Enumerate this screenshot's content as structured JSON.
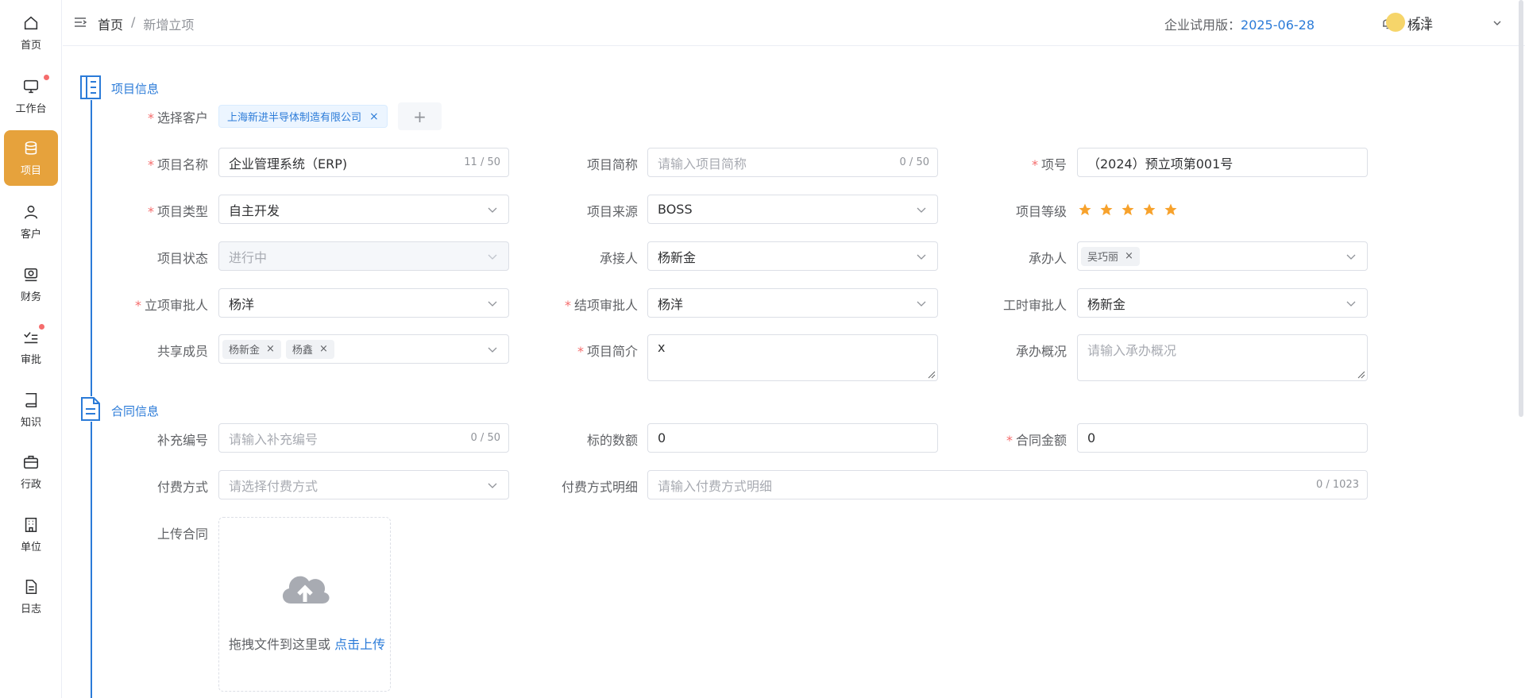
{
  "sidebar": {
    "items": [
      {
        "label": "首页",
        "icon": "home-icon"
      },
      {
        "label": "工作台",
        "icon": "monitor-icon",
        "badge": true
      },
      {
        "label": "项目",
        "icon": "database-icon",
        "active": true
      },
      {
        "label": "客户",
        "icon": "user-icon"
      },
      {
        "label": "财务",
        "icon": "money-icon"
      },
      {
        "label": "审批",
        "icon": "checklist-icon",
        "badge": true
      },
      {
        "label": "知识",
        "icon": "book-icon"
      },
      {
        "label": "行政",
        "icon": "briefcase-icon"
      },
      {
        "label": "单位",
        "icon": "building-icon"
      },
      {
        "label": "日志",
        "icon": "document-icon"
      }
    ]
  },
  "header": {
    "breadcrumb": [
      "首页",
      "/",
      "新增立项"
    ],
    "trial_label": "企业试用版：",
    "trial_date": "2025-06-28",
    "username": "杨洋"
  },
  "sections": {
    "project_info": "项目信息",
    "contract_info": "合同信息"
  },
  "form": {
    "customer": {
      "label": "选择客户",
      "tag": "上海新进半导体制造有限公司"
    },
    "project_name": {
      "label": "项目名称",
      "value": "企业管理系统（ERP)",
      "count": "11 / 50"
    },
    "project_short": {
      "label": "项目简称",
      "placeholder": "请输入项目简称",
      "count": "0 / 50"
    },
    "project_no": {
      "label": "项号",
      "value": "（2024）预立项第001号"
    },
    "project_type": {
      "label": "项目类型",
      "value": "自主开发"
    },
    "project_source": {
      "label": "项目来源",
      "value": "BOSS"
    },
    "project_level": {
      "label": "项目等级",
      "stars": 5
    },
    "project_status": {
      "label": "项目状态",
      "value": "进行中"
    },
    "receiver": {
      "label": "承接人",
      "value": "杨新金"
    },
    "handler": {
      "label": "承办人",
      "tags": [
        "吴巧丽"
      ]
    },
    "approver": {
      "label": "立项审批人",
      "value": "杨洋"
    },
    "close_approver": {
      "label": "结项审批人",
      "value": "杨洋"
    },
    "hour_approver": {
      "label": "工时审批人",
      "value": "杨新金"
    },
    "members": {
      "label": "共享成员",
      "tags": [
        "杨新金",
        "杨鑫"
      ]
    },
    "intro": {
      "label": "项目简介",
      "value": "x"
    },
    "handle_summary": {
      "label": "承办概况",
      "placeholder": "请输入承办概况"
    },
    "supp_no": {
      "label": "补充编号",
      "placeholder": "请输入补充编号",
      "count": "0 / 50"
    },
    "subject_count": {
      "label": "标的数额",
      "value": "0"
    },
    "contract_amount": {
      "label": "合同金额",
      "value": "0"
    },
    "pay_method": {
      "label": "付费方式",
      "placeholder": "请选择付费方式"
    },
    "pay_detail": {
      "label": "付费方式明细",
      "placeholder": "请输入付费方式明细",
      "count": "0 / 1023"
    },
    "upload": {
      "label": "上传合同",
      "text": "拖拽文件到这里或 ",
      "link": "点击上传"
    }
  },
  "colors": {
    "accent": "#2b7bd8",
    "active_nav": "#e6a23c",
    "required": "#f56c6c",
    "star": "#f7a22c"
  }
}
